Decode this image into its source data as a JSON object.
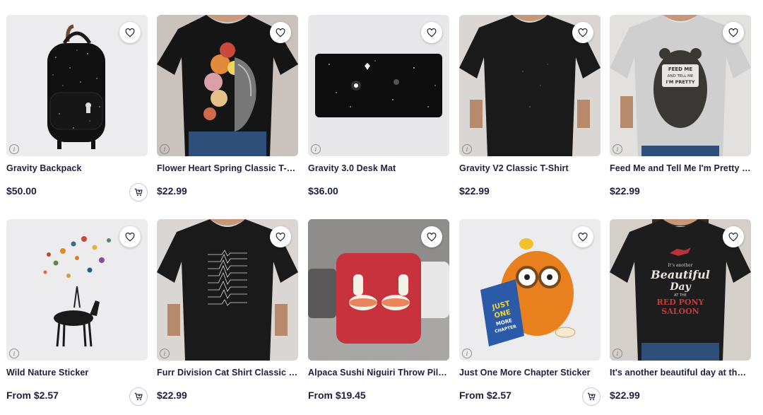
{
  "products": [
    {
      "title": "Gravity Backpack",
      "price": "$50.00",
      "has_cart": true,
      "icon": "heart-icon"
    },
    {
      "title": "Flower Heart Spring Classic T-Shirt",
      "price": "$22.99",
      "has_cart": false
    },
    {
      "title": "Gravity 3.0 Desk Mat",
      "price": "$36.00",
      "has_cart": false
    },
    {
      "title": "Gravity V2 Classic T-Shirt",
      "price": "$22.99",
      "has_cart": false
    },
    {
      "title": "Feed Me and Tell Me I'm Pretty Bear",
      "price": "$22.99",
      "has_cart": false
    },
    {
      "title": "Wild Nature Sticker",
      "price": "From $2.57",
      "has_cart": true
    },
    {
      "title": "Furr Division Cat Shirt Classic T-Shirt",
      "price": "$22.99",
      "has_cart": false
    },
    {
      "title": "Alpaca Sushi Niguiri Throw Pillow",
      "price": "From $19.45",
      "has_cart": false
    },
    {
      "title": "Just One More Chapter Sticker",
      "price": "From $2.57",
      "has_cart": true
    },
    {
      "title": "It's another beautiful day at the red pony saloon",
      "price": "$22.99",
      "has_cart": false
    }
  ],
  "art_text": {
    "bear_sign": [
      "FEED ME",
      "AND TELL ME",
      "I'M PRETTY"
    ],
    "book": [
      "JUST",
      "ONE",
      "MORE",
      "CHAPTER"
    ],
    "saloon": [
      "It's another",
      "Beautiful",
      "Day",
      "AT THE",
      "RED PONY",
      "SALOON"
    ]
  },
  "colors": {
    "text": "#1e1e3f",
    "card_bg": "#ececee"
  }
}
